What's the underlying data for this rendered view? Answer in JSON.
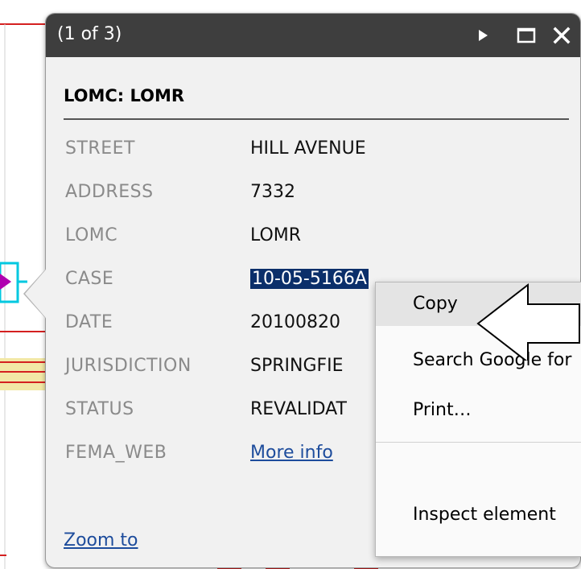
{
  "popup": {
    "counter": "(1 of 3)",
    "icons": [
      "play-icon",
      "maximize-icon",
      "close-icon"
    ],
    "heading": "LOMC: LOMR",
    "fields": [
      {
        "key": "STREET",
        "value": "HILL AVENUE"
      },
      {
        "key": "ADDRESS",
        "value": "7332"
      },
      {
        "key": "LOMC",
        "value": "LOMR"
      },
      {
        "key": "CASE",
        "value": "10-05-5166A"
      },
      {
        "key": "DATE",
        "value": "20100820"
      },
      {
        "key": "JURISDICTION",
        "value": "SPRINGFIE"
      },
      {
        "key": "STATUS",
        "value": "REVALIDAT"
      },
      {
        "key": "FEMA_WEB",
        "value": "More info"
      }
    ],
    "zoom_link": "Zoom to"
  },
  "context_menu": {
    "items": [
      {
        "label": "Copy"
      },
      {
        "label": "Search Google for"
      },
      {
        "label": "Print…"
      },
      {
        "label": "Inspect element"
      }
    ]
  },
  "colors": {
    "titlebar": "#3e3e3e",
    "selection": "#0b2f6a",
    "link": "#1d4c9c",
    "map_red": "#d42020",
    "map_yellow": "#f2e8a6",
    "map_cyan": "#00c8e0",
    "map_magenta": "#b000b0"
  }
}
